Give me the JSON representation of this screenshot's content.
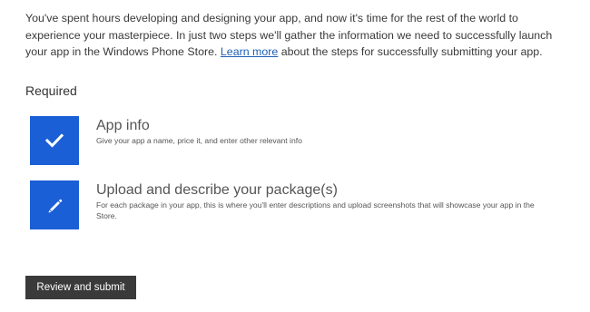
{
  "intro": {
    "text_before_link": "You've spent hours developing and designing your app, and now it's time for the rest of the world to experience your masterpiece. In just two steps we'll gather the information we need to successfully launch your app in the Windows Phone Store. ",
    "link_label": "Learn more",
    "text_after_link": " about the steps for successfully submitting your app."
  },
  "required": {
    "heading": "Required",
    "steps": [
      {
        "title": "App info",
        "description": "Give your app a name, price it, and enter other relevant info",
        "icon": "checkmark-icon",
        "status": "completed"
      },
      {
        "title": "Upload and describe your package(s)",
        "description": "For each package in your app, this is where you'll enter descriptions and upload screenshots that will showcase your app in the Store.",
        "icon": "pencil-icon",
        "status": "pending"
      }
    ]
  },
  "actions": {
    "review_submit_label": "Review and submit"
  },
  "colors": {
    "accent": "#1a5fd6",
    "link": "#1e5fb3",
    "button_bg": "#3a3a3a"
  }
}
